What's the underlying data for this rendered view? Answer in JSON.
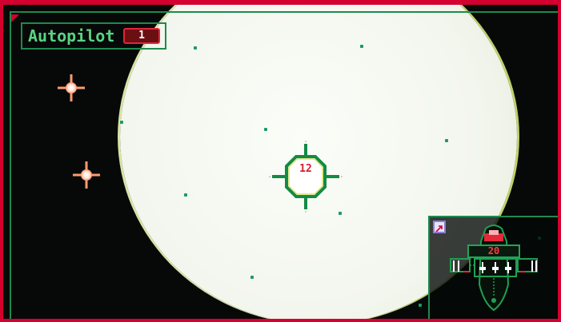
{
  "hud": {
    "autopilot": {
      "label": "Autopilot",
      "value": "1"
    },
    "target": {
      "distance": "12"
    },
    "ship_status": {
      "speed": "20"
    }
  },
  "colors": {
    "frame_red": "#d4002f",
    "hud_green": "#1e8a4f",
    "text_green": "#58d483",
    "readout_red": "#d91b2f",
    "space": "#070908",
    "planet": "#f3f6ee"
  },
  "icons": {
    "mode": "nav-mode-icon",
    "reticle": "target-reticle-icon",
    "ship": "ship-schematic-icon"
  }
}
